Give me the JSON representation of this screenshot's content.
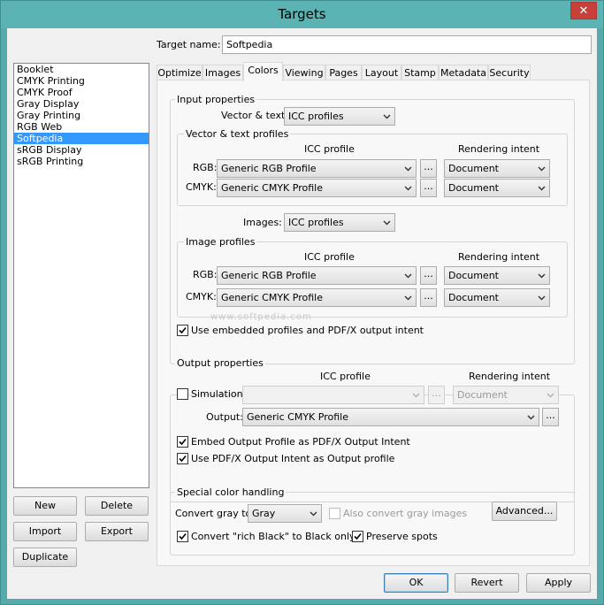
{
  "window": {
    "title": "Targets",
    "close_glyph": "✕"
  },
  "target_name": {
    "label": "Target name:",
    "value": "Softpedia"
  },
  "targets_list": {
    "items": [
      "Booklet",
      "CMYK Printing",
      "CMYK Proof",
      "Gray Display",
      "Gray Printing",
      "RGB Web",
      "Softpedia",
      "sRGB Display",
      "sRGB Printing"
    ],
    "selected_index": 6
  },
  "left_buttons": {
    "new": "New",
    "delete": "Delete",
    "import": "Import",
    "export": "Export",
    "duplicate": "Duplicate"
  },
  "tabs": [
    "Optimize",
    "Images",
    "Colors",
    "Viewing",
    "Pages",
    "Layout",
    "Stamp",
    "Metadata",
    "Security"
  ],
  "active_tab": "Colors",
  "input_properties": {
    "title": "Input properties",
    "vector_text_label": "Vector & text:",
    "vector_text_value": "ICC profiles",
    "vector_profiles": {
      "title": "Vector & text profiles",
      "col_icc": "ICC profile",
      "col_intent": "Rendering intent",
      "rgb_label": "RGB:",
      "rgb_profile": "Generic RGB Profile",
      "rgb_intent": "Document",
      "cmyk_label": "CMYK:",
      "cmyk_profile": "Generic CMYK Profile",
      "cmyk_intent": "Document"
    },
    "images_label": "Images:",
    "images_value": "ICC profiles",
    "image_profiles": {
      "title": "Image profiles",
      "col_icc": "ICC profile",
      "col_intent": "Rendering intent",
      "rgb_label": "RGB:",
      "rgb_profile": "Generic RGB Profile",
      "rgb_intent": "Document",
      "cmyk_label": "CMYK:",
      "cmyk_profile": "Generic CMYK Profile",
      "cmyk_intent": "Document"
    },
    "use_embedded_label": "Use embedded profiles and PDF/X output intent",
    "use_embedded_checked": true
  },
  "output_properties": {
    "title": "Output properties",
    "col_icc": "ICC profile",
    "col_intent": "Rendering intent",
    "simulation_label": "Simulation:",
    "simulation_checked": false,
    "simulation_profile": "",
    "simulation_intent": "Document",
    "output_label": "Output:",
    "output_profile": "Generic CMYK Profile",
    "embed_output_label": "Embed Output Profile as PDF/X Output Intent",
    "embed_output_checked": true,
    "use_pdfx_label": "Use PDF/X Output Intent as Output profile",
    "use_pdfx_checked": true
  },
  "special_color": {
    "title": "Special color handling",
    "convert_gray_label": "Convert gray to:",
    "convert_gray_value": "Gray",
    "also_convert_label": "Also convert gray images",
    "also_convert_checked": false,
    "advanced_label": "Advanced...",
    "rich_black_label": "Convert \"rich Black\" to Black only",
    "rich_black_checked": true,
    "preserve_spots_label": "Preserve spots",
    "preserve_spots_checked": true
  },
  "dialog_buttons": {
    "ok": "OK",
    "revert": "Revert",
    "apply": "Apply"
  },
  "ellipsis": "...",
  "watermark": "www.softpedia.com"
}
